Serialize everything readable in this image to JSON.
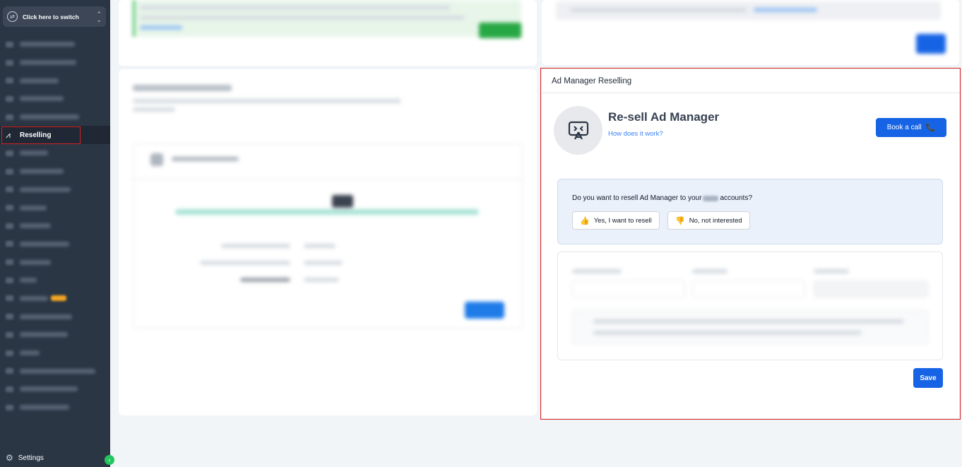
{
  "sidebar": {
    "switcher_label": "Click here to switch",
    "active_item": {
      "label": "Reselling",
      "icon": "reselling-icon"
    },
    "settings_label": "Settings"
  },
  "ad_manager": {
    "panel_title": "Ad Manager Reselling",
    "hero_title": "Re-sell Ad Manager",
    "hero_link": "How does it work?",
    "book_call_label": "Book a call",
    "question_prefix": "Do you want to resell Ad Manager to your",
    "question_suffix": "accounts?",
    "yes_label": "Yes, I want to resell",
    "no_label": "No, not interested",
    "save_label": "Save"
  },
  "colors": {
    "primary": "#1664e5",
    "sidebar_bg": "#2b3645",
    "highlight_outline": "#d92020",
    "question_bg": "#eaf1fb"
  }
}
